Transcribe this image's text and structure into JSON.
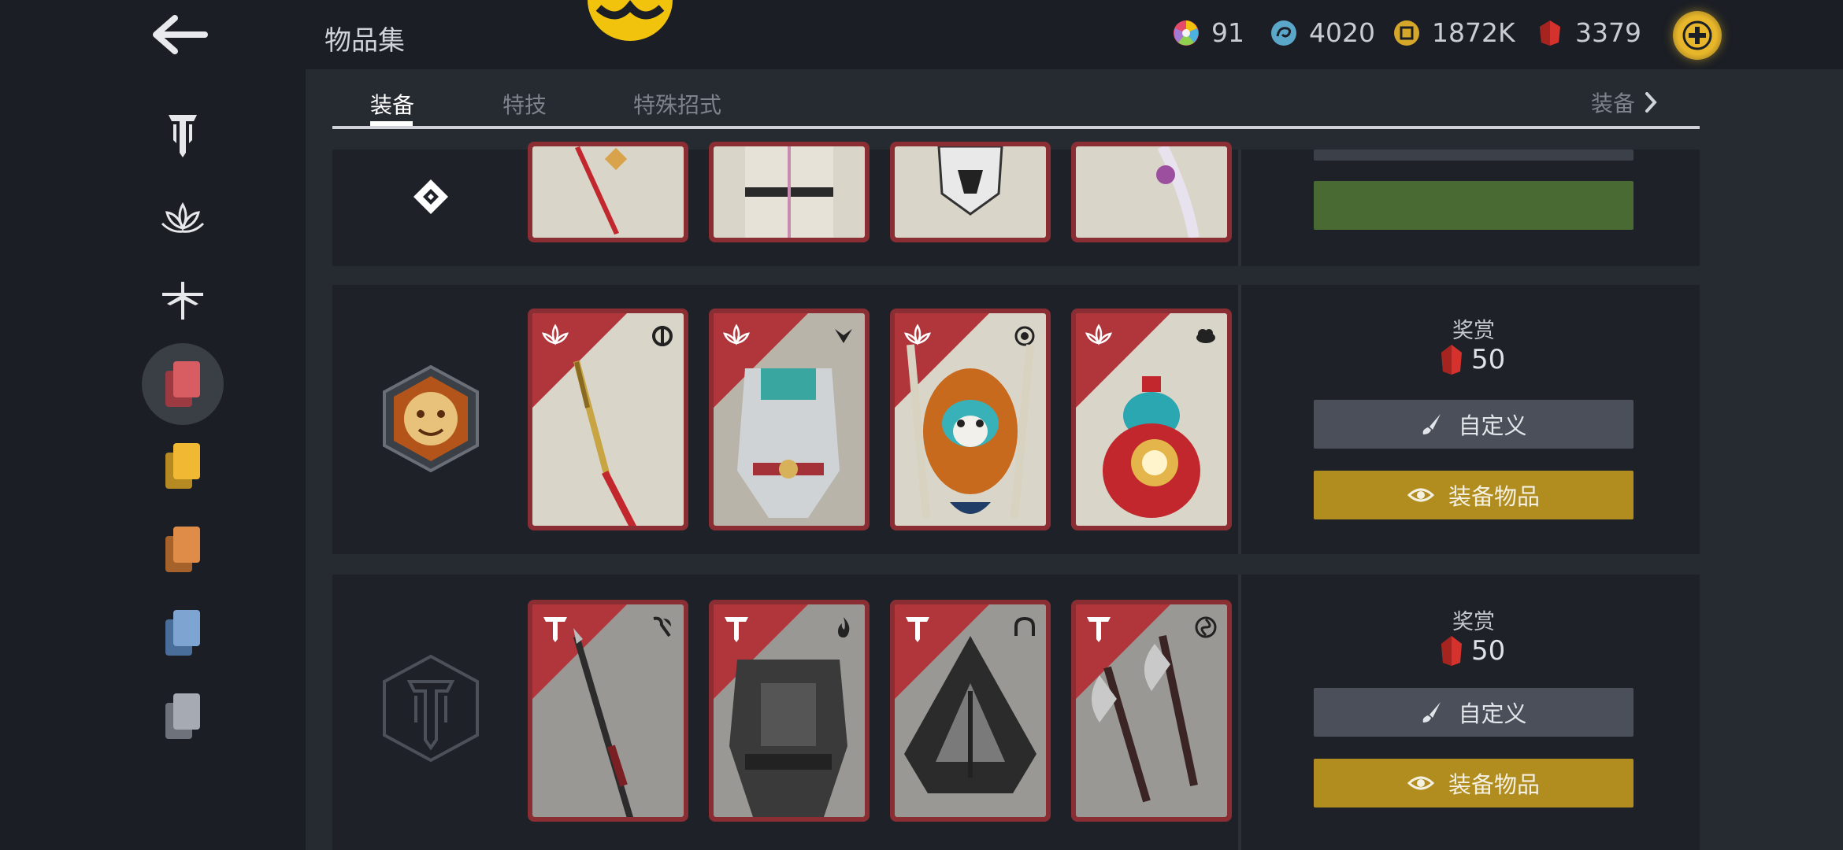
{
  "header": {
    "title": "物品集",
    "currencies": [
      {
        "icon": "color-wheel-icon",
        "value": "91"
      },
      {
        "icon": "swirl-icon",
        "value": "4020"
      },
      {
        "icon": "steel-coin-icon",
        "value": "1872K"
      },
      {
        "icon": "red-gem-icon",
        "value": "3379"
      }
    ]
  },
  "tabs": [
    {
      "label": "装备",
      "active": true
    },
    {
      "label": "特技",
      "active": false
    },
    {
      "label": "特殊招式",
      "active": false
    }
  ],
  "tab_more_label": "装备",
  "sidebar": {
    "items": [
      {
        "icon": "knights-faction-icon",
        "active": false
      },
      {
        "icon": "lotus-faction-icon",
        "active": false
      },
      {
        "icon": "dragonfly-faction-icon",
        "active": false
      },
      {
        "icon": "red-cards-icon",
        "active": true
      },
      {
        "icon": "yellow-cards-icon",
        "active": false
      },
      {
        "icon": "orange-cards-icon",
        "active": false
      },
      {
        "icon": "blue-cards-icon",
        "active": false
      },
      {
        "icon": "grey-cards-icon",
        "active": false
      }
    ]
  },
  "rows": [
    {
      "emblem": "diamond-emblem-icon",
      "cards": [
        "red-weapon-art",
        "armor-art",
        "helmet-art",
        "bow-art"
      ],
      "partial": true
    },
    {
      "emblem": "monkey-hero-emblem-icon",
      "reward_label": "奖赏",
      "reward_value": "50",
      "customize_label": "自定义",
      "equip_label": "装备物品",
      "cards": [
        "golden-staff-art",
        "dragon-armor-art",
        "monkey-mask-art",
        "gourd-art"
      ],
      "card_type_icons": [
        "half-circle-icon",
        "arrow-down-icon",
        "eye-ring-icon",
        "cloud-icon"
      ]
    },
    {
      "emblem": "knights-hero-emblem-icon",
      "reward_label": "奖赏",
      "reward_value": "50",
      "customize_label": "自定义",
      "equip_label": "装备物品",
      "cards": [
        "spear-art",
        "dark-armor-art",
        "hood-art",
        "axes-art"
      ],
      "card_type_icons": [
        "axe-icon",
        "flame-icon",
        "arch-icon",
        "swirl-icon"
      ]
    }
  ]
}
